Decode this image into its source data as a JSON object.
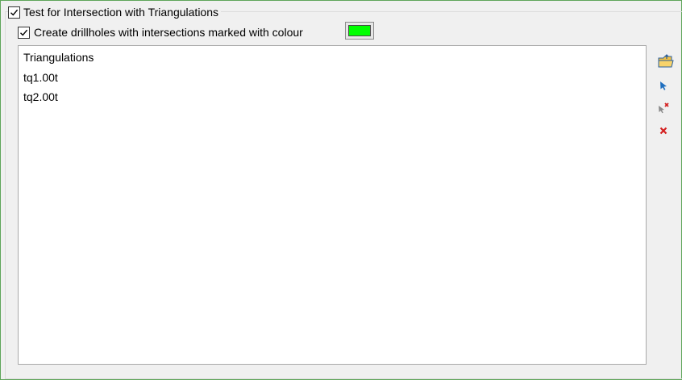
{
  "group": {
    "title": "Test for Intersection with Triangulations",
    "checked": true
  },
  "drillholes": {
    "label": "Create drillholes with intersections marked with colour",
    "checked": true,
    "colour": "#00ff00"
  },
  "list": {
    "header": "Triangulations",
    "items": [
      "tq1.00t",
      "tq2.00t"
    ]
  },
  "toolbar": {
    "icons": [
      "open-folder-icon",
      "select-arrow-icon",
      "unselect-arrow-icon",
      "delete-icon"
    ]
  },
  "colors": {
    "frame": "#5fa55a",
    "folder": "#f5c242",
    "select_arrow": "#1f6fbf",
    "delete": "#d42020"
  }
}
